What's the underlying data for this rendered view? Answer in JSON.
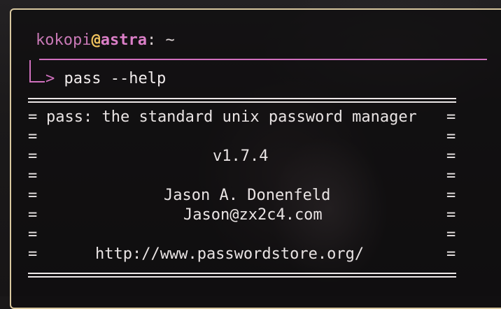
{
  "prompt": {
    "user": "kokopi",
    "at": "@",
    "host": "astra",
    "colon": ":",
    "path": "~"
  },
  "command_line": {
    "arrow": ">",
    "command": "pass --help"
  },
  "help_output": {
    "border_char": "=",
    "rows": [
      "pass: the standard unix password manager",
      "",
      "v1.7.4",
      "",
      "Jason A. Donenfeld",
      "Jason@zx2c4.com",
      "",
      "http://www.passwordstore.org/"
    ]
  },
  "colors": {
    "window_border": "#d8c79f",
    "accent_pink": "#d070be",
    "at_sign": "#f1c35e",
    "text": "#e9e4e4"
  }
}
